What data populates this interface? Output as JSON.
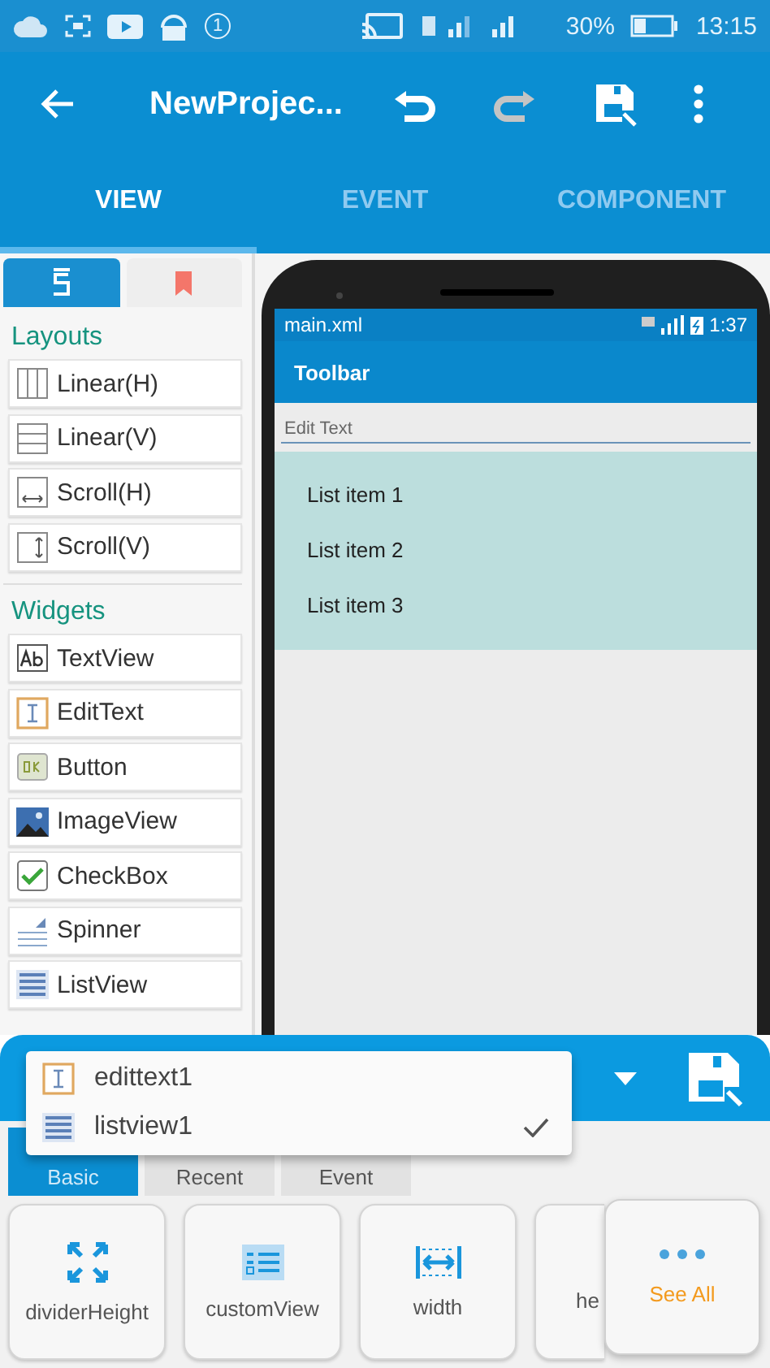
{
  "status_bar": {
    "notification_count": "1",
    "battery": "30%",
    "time": "13:15"
  },
  "app_bar": {
    "title": "NewProjec...",
    "actions": [
      {
        "kind": "undo",
        "disabled": false
      },
      {
        "kind": "redo",
        "disabled": true
      },
      {
        "kind": "save"
      },
      {
        "kind": "more"
      }
    ]
  },
  "tabs": [
    {
      "label": "VIEW",
      "selected": true
    },
    {
      "label": "EVENT",
      "selected": false
    },
    {
      "label": "COMPONENT",
      "selected": false
    }
  ],
  "palette": {
    "tabs": [
      {
        "kind": "widgets",
        "selected": true
      },
      {
        "kind": "bookmark",
        "selected": false
      }
    ],
    "sections": [
      {
        "title": "Layouts",
        "items": [
          {
            "label": "Linear(H)",
            "kind": "linear-h"
          },
          {
            "label": "Linear(V)",
            "kind": "linear-v"
          },
          {
            "label": "Scroll(H)",
            "kind": "scroll-h"
          },
          {
            "label": "Scroll(V)",
            "kind": "scroll-v"
          }
        ]
      },
      {
        "title": "Widgets",
        "items": [
          {
            "label": "TextView",
            "kind": "textview"
          },
          {
            "label": "EditText",
            "kind": "edittext"
          },
          {
            "label": "Button",
            "kind": "button"
          },
          {
            "label": "ImageView",
            "kind": "imageview"
          },
          {
            "label": "CheckBox",
            "kind": "checkbox"
          },
          {
            "label": "Spinner",
            "kind": "spinner"
          },
          {
            "label": "ListView",
            "kind": "listview"
          }
        ]
      }
    ]
  },
  "preview": {
    "file": "main.xml",
    "time": "1:37",
    "toolbar": "Toolbar",
    "edit_text": {
      "placeholder": "Edit Text"
    },
    "list_items": [
      "List item 1",
      "List item 2",
      "List item 3"
    ]
  },
  "bottom_sheet": {
    "menu": [
      {
        "label": "edittext1",
        "kind": "edittext",
        "selected": false
      },
      {
        "label": "listview1",
        "kind": "listview",
        "selected": true
      }
    ],
    "tabs": [
      {
        "label": "Basic",
        "selected": true
      },
      {
        "label": "Recent",
        "selected": false
      },
      {
        "label": "Event",
        "selected": false
      }
    ],
    "properties": [
      {
        "label": "dividerHeight",
        "kind": "expand"
      },
      {
        "label": "customView",
        "kind": "list"
      },
      {
        "label": "width",
        "kind": "width"
      },
      {
        "label": "he"
      }
    ],
    "see_all": "See All"
  }
}
